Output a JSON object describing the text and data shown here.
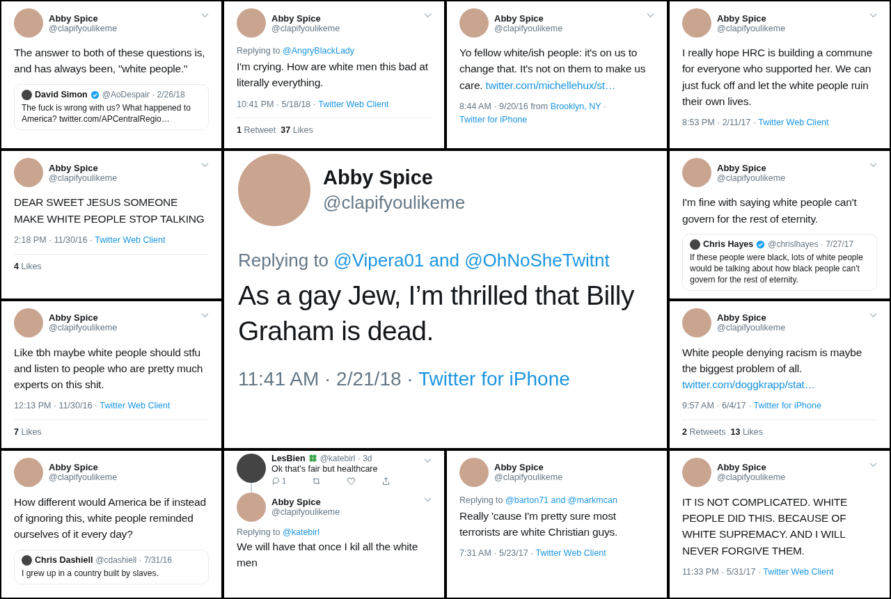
{
  "tiles": [
    {
      "kind": "tweet",
      "name": "Abby Spice",
      "handle": "@clapifyoulikeme",
      "menu": true,
      "text": "The answer to both of these questions is, and has always been, \"white people.\"",
      "quote": {
        "name": "David Simon",
        "badge": {
          "kind": "verified"
        },
        "handle": "@AoDespair · 2/26/18",
        "text": "The fuck is wrong with us? What happened to America? twitter.com/APCentralRegio…"
      }
    },
    {
      "kind": "tweet",
      "name": "Abby Spice",
      "handle": "@clapifyoulikeme",
      "menu": true,
      "reply": {
        "label": "Replying to",
        "to": "@AngryBlackLady"
      },
      "text": "I'm crying. How are white men this bad at literally everything.",
      "meta": [
        {
          "text": "10:41 PM · 5/18/18 · ",
          "link": false
        },
        {
          "text": "Twitter Web Client",
          "link": true
        }
      ],
      "stats": [
        {
          "count": "1",
          "label": "Retweet"
        },
        {
          "count": "37",
          "label": "Likes"
        }
      ]
    },
    {
      "kind": "tweet",
      "name": "Abby Spice",
      "handle": "@clapifyoulikeme",
      "menu": true,
      "text": "Yo fellow white/ish people: it's on us to change that. It's not on them to make us care.",
      "link": "twitter.com/michellehux/st…",
      "meta": [
        {
          "text": "8:44 AM · 9/20/16 from ",
          "link": false
        },
        {
          "text": "Brooklyn, NY",
          "link": true
        },
        {
          "text": " · ",
          "link": false
        },
        {
          "text": "Twitter for iPhone",
          "link": true
        }
      ]
    },
    {
      "kind": "tweet",
      "name": "Abby Spice",
      "handle": "@clapifyoulikeme",
      "menu": true,
      "text": "I really hope HRC is building a commune for everyone who supported her. We can just fuck off and let the white people ruin their own lives.",
      "meta": [
        {
          "text": "8:53 PM · 2/11/17 · ",
          "link": false
        },
        {
          "text": "Twitter Web Client",
          "link": true
        }
      ]
    },
    {
      "kind": "tweet",
      "name": "Abby Spice",
      "handle": "@clapifyoulikeme",
      "menu": true,
      "text": "DEAR SWEET JESUS SOMEONE MAKE WHITE PEOPLE STOP TALKING",
      "meta": [
        {
          "text": "2:18 PM · 11/30/16 · ",
          "link": false
        },
        {
          "text": "Twitter Web Client",
          "link": true
        }
      ],
      "stats": [
        {
          "count": "4",
          "label": "Likes"
        }
      ]
    },
    {
      "kind": "feature",
      "name": "Abby Spice",
      "handle": "@clapifyoulikeme",
      "menu": false,
      "reply": {
        "label": "Replying to",
        "to": "@Vipera01 and @OhNoSheTwitnt"
      },
      "text": "As a gay Jew, I’m thrilled that Billy Graham is dead.",
      "meta": [
        {
          "text": "11:41 AM · 2/21/18 · ",
          "link": false
        },
        {
          "text": "Twitter for iPhone",
          "link": true
        }
      ]
    },
    {
      "kind": "tweet",
      "name": "Abby Spice",
      "handle": "@clapifyoulikeme",
      "menu": true,
      "text": "I'm fine with saying white people can't govern for the rest of eternity.",
      "quote": {
        "name": "Chris Hayes",
        "badge": {
          "kind": "verified"
        },
        "handle": "@chrislhayes · 7/27/17",
        "text": "If these people were black, lots of white people would be talking about how black people can't govern for the rest of eternity."
      }
    },
    {
      "kind": "tweet",
      "name": "Abby Spice",
      "handle": "@clapifyoulikeme",
      "menu": true,
      "text": "Like tbh maybe white people should stfu and listen to people who are pretty much experts on this shit.",
      "meta": [
        {
          "text": "12:13 PM · 11/30/16 · ",
          "link": false
        },
        {
          "text": "Twitter Web Client",
          "link": true
        }
      ],
      "stats": [
        {
          "count": "7",
          "label": "Likes"
        }
      ]
    },
    {
      "kind": "tweet",
      "name": "Abby Spice",
      "handle": "@clapifyoulikeme",
      "menu": true,
      "text": "White people denying racism is maybe the biggest problem of all.",
      "link": "twitter.com/doggkrapp/stat…",
      "meta": [
        {
          "text": "9:57 AM · 6/4/17 · ",
          "link": false
        },
        {
          "text": "Twitter for iPhone",
          "link": true
        }
      ],
      "stats": [
        {
          "count": "2",
          "label": "Retweets"
        },
        {
          "count": "13",
          "label": "Likes"
        }
      ]
    },
    {
      "kind": "tweet",
      "name": "Abby Spice",
      "handle": "@clapifyoulikeme",
      "menu": false,
      "text": "How different would America be if instead of ignoring this, white people reminded ourselves of it every day?",
      "quote": {
        "name": "Chris Dashiell",
        "handle": "@cdashiell · 7/31/16",
        "text": "I grew up in a country built by slaves."
      }
    },
    {
      "kind": "thread",
      "parent": {
        "name": "LesBien",
        "badge": {
          "kind": "clover"
        },
        "handle": "@katebirl · 3d",
        "text": "Ok that's fair but healthcare",
        "actions": [
          {
            "kind": "reply",
            "count": "1"
          },
          {
            "kind": "retweet"
          },
          {
            "kind": "like"
          },
          {
            "kind": "share"
          }
        ]
      },
      "name": "Abby Spice",
      "handle": "@clapifyoulikeme",
      "menu": true,
      "reply": {
        "label": "Replying to",
        "to": "@katebirl"
      },
      "text": "We will have that once I kil all the white men"
    },
    {
      "kind": "tweet",
      "name": "Abby Spice",
      "handle": "@clapifyoulikeme",
      "menu": false,
      "reply": {
        "label": "Replying to",
        "to": "@barton71 and @markmcan"
      },
      "text": "Really 'cause I'm pretty sure most terrorists are white Christian guys.",
      "meta": [
        {
          "text": "7:31 AM · 5/23/17 · ",
          "link": false
        },
        {
          "text": "Twitter Web Client",
          "link": true
        }
      ]
    },
    {
      "kind": "tweet",
      "name": "Abby Spice",
      "handle": "@clapifyoulikeme",
      "menu": true,
      "text": "IT IS NOT COMPLICATED. WHITE PEOPLE DID THIS. BECAUSE OF WHITE SUPREMACY. AND I WILL NEVER FORGIVE THEM.",
      "meta": [
        {
          "text": "11:33 PM · 5/31/17 · ",
          "link": false
        },
        {
          "text": "Twitter Web Client",
          "link": true
        }
      ]
    }
  ]
}
